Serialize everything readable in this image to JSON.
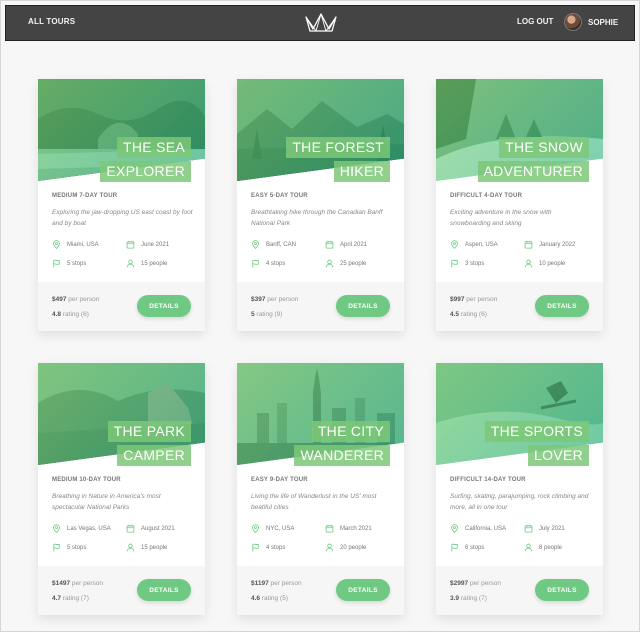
{
  "header": {
    "all_tours": "ALL TOURS",
    "logout": "LOG OUT",
    "user_name": "SOPHIE"
  },
  "colors": {
    "accent": "#6fc982",
    "header_bg": "#444444"
  },
  "tours": [
    {
      "title_line1": "THE SEA",
      "title_line2": "EXPLORER",
      "subtitle": "MEDIUM 7-DAY TOUR",
      "summary": "Exploring the jaw-dropping US east coast by foot and by boat",
      "location": "Miami, USA",
      "date": "June 2021",
      "stops": "5 stops",
      "people": "15 people",
      "price": "$497",
      "price_suffix": " per person",
      "rating": "4.8",
      "rating_suffix": " rating (6)",
      "button": "DETAILS"
    },
    {
      "title_line1": "THE FOREST",
      "title_line2": "HIKER",
      "subtitle": "EASY 5-DAY TOUR",
      "summary": "Breathtaking hike through the Canadian Banff National Park",
      "location": "Banff, CAN",
      "date": "April 2021",
      "stops": "4 stops",
      "people": "25 people",
      "price": "$397",
      "price_suffix": " per person",
      "rating": "5",
      "rating_suffix": " rating (9)",
      "button": "DETAILS"
    },
    {
      "title_line1": "THE SNOW",
      "title_line2": "ADVENTURER",
      "subtitle": "DIFFICULT 4-DAY TOUR",
      "summary": "Exciting adventure in the snow with snowboarding and skiing",
      "location": "Aspen, USA",
      "date": "January 2022",
      "stops": "3 stops",
      "people": "10 people",
      "price": "$997",
      "price_suffix": " per person",
      "rating": "4.5",
      "rating_suffix": " rating (6)",
      "button": "DETAILS"
    },
    {
      "title_line1": "THE PARK",
      "title_line2": "CAMPER",
      "subtitle": "MEDIUM 10-DAY TOUR",
      "summary": "Breathing in Nature in America's most spectacular National Parks",
      "location": "Las Vegas, USA",
      "date": "August 2021",
      "stops": "5 stops",
      "people": "15 people",
      "price": "$1497",
      "price_suffix": " per person",
      "rating": "4.7",
      "rating_suffix": " rating (7)",
      "button": "DETAILS"
    },
    {
      "title_line1": "THE CITY",
      "title_line2": "WANDERER",
      "subtitle": "EASY 9-DAY TOUR",
      "summary": "Living the life of Wanderlust in the US' most beatiful cities",
      "location": "NYC, USA",
      "date": "March 2021",
      "stops": "4 stops",
      "people": "20 people",
      "price": "$1197",
      "price_suffix": " per person",
      "rating": "4.6",
      "rating_suffix": " rating (5)",
      "button": "DETAILS"
    },
    {
      "title_line1": "THE SPORTS",
      "title_line2": "LOVER",
      "subtitle": "DIFFICULT 14-DAY TOUR",
      "summary": "Surfing, skating, parajumping, rock climbing and more, all in one tour",
      "location": "California, USA",
      "date": "July 2021",
      "stops": "6 stops",
      "people": "8 people",
      "price": "$2997",
      "price_suffix": " per person",
      "rating": "3.9",
      "rating_suffix": " rating (7)",
      "button": "DETAILS"
    }
  ]
}
